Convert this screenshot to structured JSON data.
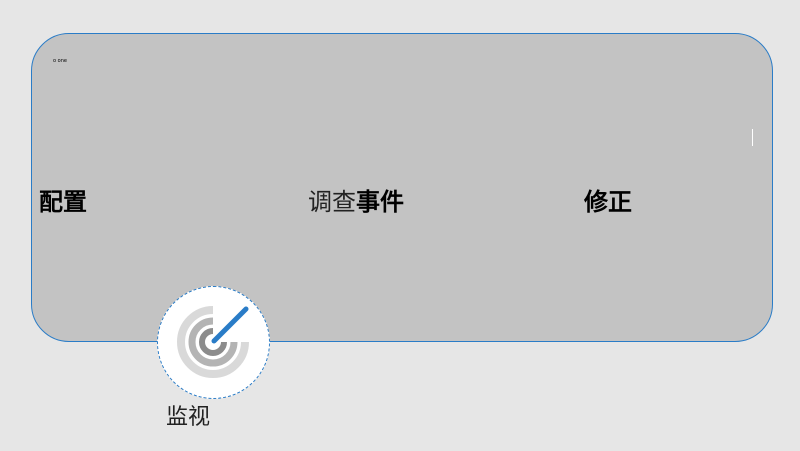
{
  "panel": {
    "small_label": "o one",
    "stages": {
      "configure": "配置",
      "investigate_light": "调查",
      "investigate_bold": "事件",
      "remediate": "修正"
    }
  },
  "monitor": {
    "icon": "radar-icon",
    "label": "监视"
  },
  "colors": {
    "background": "#e6e6e6",
    "panel_fill": "#c3c3c3",
    "accent_blue": "#2a7cc7",
    "icon_grey_dark": "#8c8c8c",
    "icon_grey_mid": "#b4b4b4",
    "icon_grey_light": "#d9d9d9"
  }
}
